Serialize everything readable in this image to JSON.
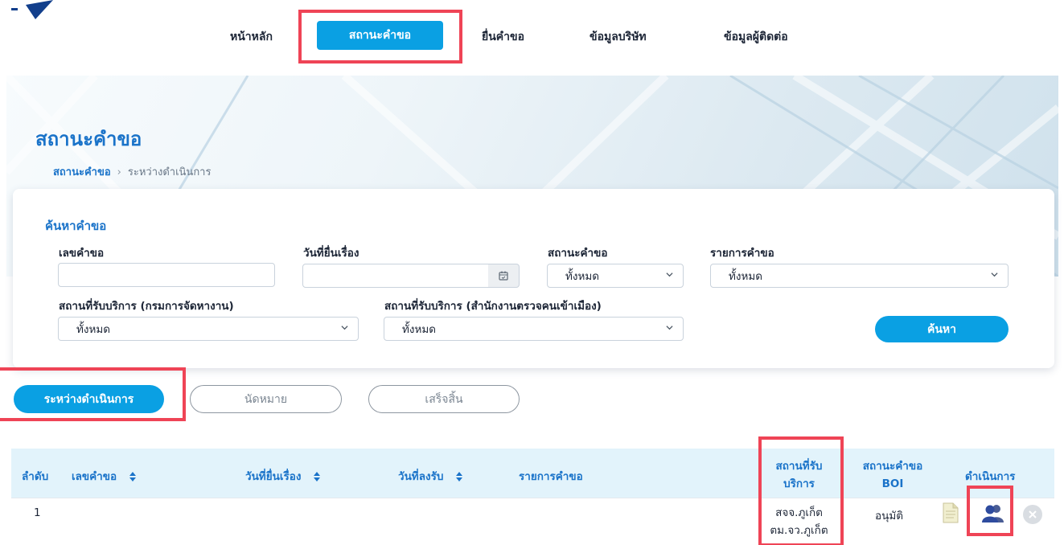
{
  "nav": {
    "items": [
      "หน้าหลัก",
      "สถานะคำขอ",
      "ยื่นคำขอ",
      "ข้อมูลบริษัท",
      "ข้อมูลผู้ติดต่อ"
    ],
    "active": "สถานะคำขอ"
  },
  "page": {
    "title": "สถานะคำขอ",
    "breadcrumb": {
      "link": "สถานะคำขอ",
      "separator": "›",
      "current": "ระหว่างดำเนินการ"
    }
  },
  "search": {
    "title": "ค้นหาคำขอ",
    "request_no_label": "เลขคำขอ",
    "request_no_value": "",
    "submit_date_label": "วันที่ยื่นเรื่อง",
    "submit_date_value": "",
    "status_label": "สถานะคำขอ",
    "status_value": "ทั้งหมด",
    "request_type_label": "รายการคำขอ",
    "request_type_value": "ทั้งหมด",
    "service_doe_label": "สถานที่รับบริการ (กรมการจัดหางาน)",
    "service_doe_value": "ทั้งหมด",
    "service_imm_label": "สถานที่รับบริการ (สำนักงานตรวจคนเข้าเมือง)",
    "service_imm_value": "ทั้งหมด",
    "submit_label": "ค้นหา"
  },
  "tabs": {
    "in_progress": "ระหว่างดำเนินการ",
    "appointment": "นัดหมาย",
    "completed": "เสร็จสิ้น"
  },
  "table": {
    "headers": {
      "index": "ลำดับ",
      "request_no": "เลขคำขอ",
      "submit_date": "วันที่ยื่นเรื่อง",
      "signed_date": "วันที่ลงรับ",
      "request_type": "รายการคำขอ",
      "service_place_line1": "สถานที่รับ",
      "service_place_line2": "บริการ",
      "boi_line1": "สถานะคำขอ",
      "boi_line2": "BOI",
      "action": "ดำเนินการ"
    },
    "rows": [
      {
        "index": "1",
        "request_no": "",
        "submit_date": "",
        "signed_date": "",
        "request_type": "",
        "service_place_line1": "สจจ.ภูเก็ต",
        "service_place_line2": "ตม.จว.ภูเก็ต",
        "boi_status": "อนุมัติ"
      }
    ]
  },
  "icons": {
    "calendar": "calendar-icon",
    "sort": "sort-icon",
    "chevron": "chevron-down-icon",
    "document": "document-icon",
    "users": "users-icon",
    "cancel": "cancel-icon"
  },
  "colors": {
    "primary": "#0aa0e3",
    "heading": "#1a73c9",
    "highlight": "#ef4456",
    "table_header_bg": "#e2f3fb"
  }
}
